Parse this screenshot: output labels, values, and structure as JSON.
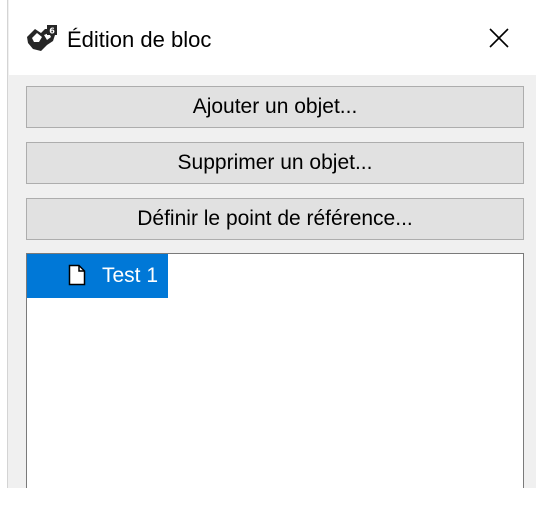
{
  "window": {
    "title": "Édition de bloc",
    "app_icon": "block-edit-icon",
    "close_icon": "close-icon"
  },
  "actions": {
    "add_object_label": "Ajouter un objet...",
    "remove_object_label": "Supprimer un objet...",
    "set_reference_point_label": "Définir le point de référence..."
  },
  "tree": {
    "items": [
      {
        "label": "Test 1",
        "icon": "document-icon",
        "selected": true
      }
    ]
  },
  "colors": {
    "selection": "#0078d7",
    "button_face": "#e1e1e1",
    "button_border": "#adadad",
    "panel_background": "#f0f0f0"
  }
}
